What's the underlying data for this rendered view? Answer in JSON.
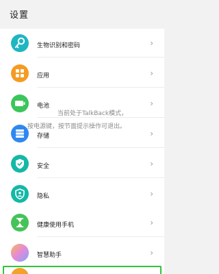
{
  "header": {
    "title": "设置"
  },
  "group1": {
    "items": [
      {
        "label": "生物识别和密码",
        "icon": "key-icon",
        "color": "#1fb6c2"
      },
      {
        "label": "应用",
        "icon": "apps-grid-icon",
        "color": "#f59b23"
      },
      {
        "label": "电池",
        "icon": "battery-icon",
        "color": "#3bc55a"
      },
      {
        "label": "存储",
        "icon": "storage-icon",
        "color": "#2f88f0"
      },
      {
        "label": "安全",
        "icon": "shield-check-icon",
        "color": "#14b8a6"
      },
      {
        "label": "隐私",
        "icon": "privacy-shield-icon",
        "color": "#14b8a6"
      }
    ]
  },
  "group2": {
    "items": [
      {
        "label": "健康使用手机",
        "icon": "hourglass-icon",
        "color": "#46c25a"
      },
      {
        "label": "智慧助手",
        "icon": "smart-assistant-icon",
        "color": "#c98ae8"
      }
    ]
  },
  "overlay": {
    "line1": "当前处于TalkBack模式，",
    "line2": "按电源键，按节面提示操作可退出。"
  },
  "chevron": "›"
}
